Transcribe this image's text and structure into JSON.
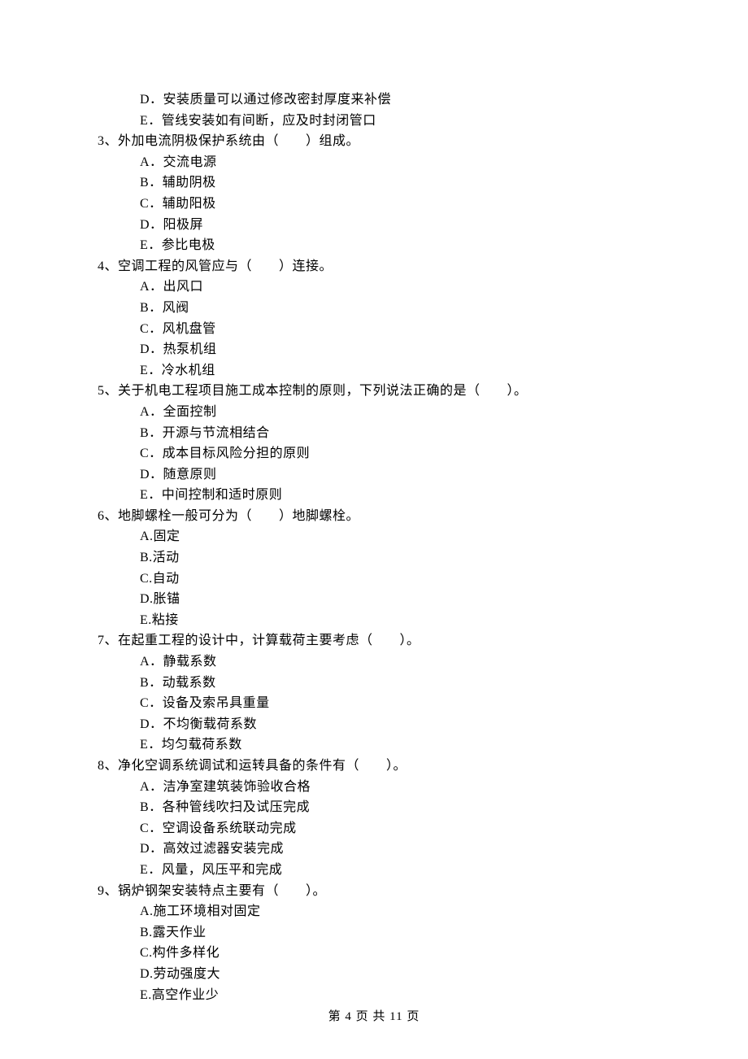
{
  "leading_options": [
    "D．安装质量可以通过修改密封厚度来补偿",
    "E．管线安装如有间断，应及时封闭管口"
  ],
  "questions": [
    {
      "stem": "3、外加电流阴极保护系统由（　　）组成。",
      "options": [
        "A．交流电源",
        "B．辅助阴极",
        "C．辅助阳极",
        "D．阳极屏",
        "E．参比电极"
      ]
    },
    {
      "stem": "4、空调工程的风管应与（　　）连接。",
      "options": [
        "A．出风口",
        "B．风阀",
        "C．风机盘管",
        "D．热泵机组",
        "E．冷水机组"
      ]
    },
    {
      "stem": "5、关于机电工程项目施工成本控制的原则，下列说法正确的是（　　）。",
      "options": [
        "A．全面控制",
        "B．开源与节流相结合",
        "C．成本目标风险分担的原则",
        "D．随意原则",
        "E．中间控制和适时原则"
      ]
    },
    {
      "stem": "6、地脚螺栓一般可分为（　　）地脚螺栓。",
      "options": [
        "A.固定",
        "B.活动",
        "C.自动",
        "D.胀锚",
        "E.粘接"
      ]
    },
    {
      "stem": "7、在起重工程的设计中，计算载荷主要考虑（　　）。",
      "options": [
        "A．静载系数",
        "B．动载系数",
        "C．设备及索吊具重量",
        "D．不均衡载荷系数",
        "E．均匀载荷系数"
      ]
    },
    {
      "stem": "8、净化空调系统调试和运转具备的条件有（　　）。",
      "options": [
        "A．洁净室建筑装饰验收合格",
        "B．各种管线吹扫及试压完成",
        "C．空调设备系统联动完成",
        "D．高效过滤器安装完成",
        "E．风量，风压平和完成"
      ]
    },
    {
      "stem": "9、锅炉钢架安装特点主要有（　　）。",
      "options": [
        "A.施工环境相对固定",
        "B.露天作业",
        "C.构件多样化",
        "D.劳动强度大",
        "E.高空作业少"
      ]
    }
  ],
  "footer": "第 4 页 共 11 页"
}
